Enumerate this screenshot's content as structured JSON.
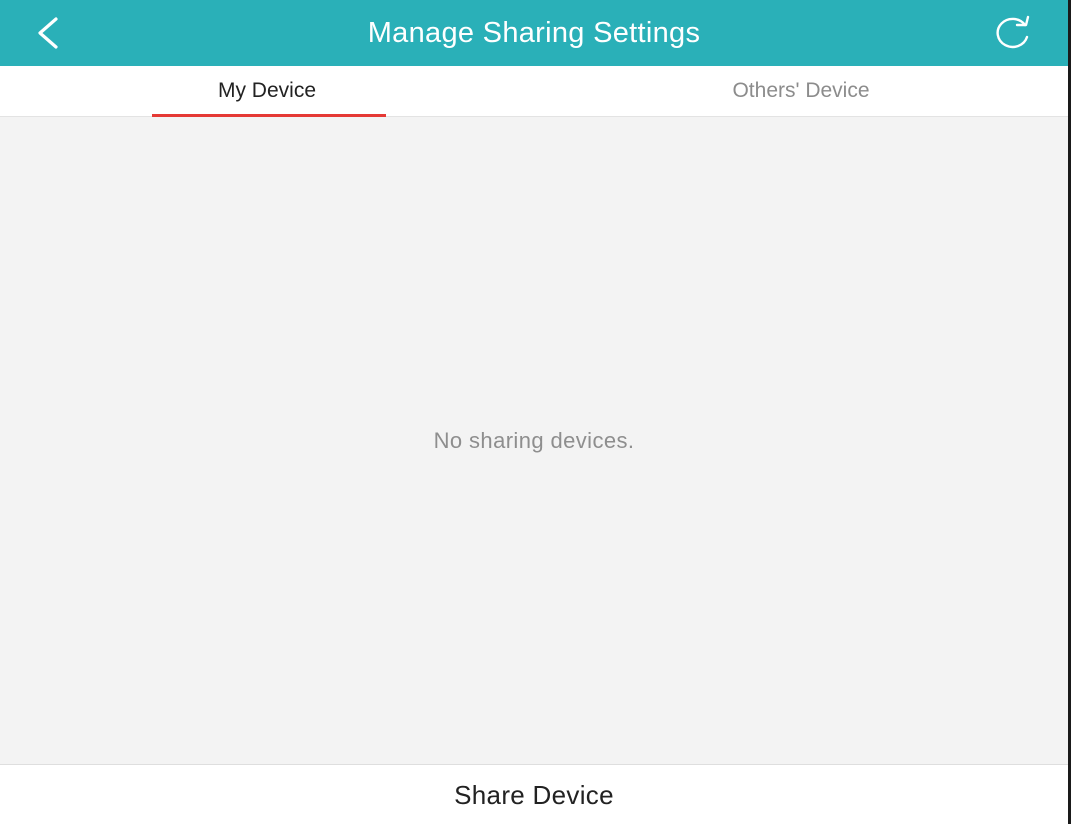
{
  "header": {
    "title": "Manage Sharing Settings",
    "back_icon": "chevron-left-icon",
    "refresh_icon": "refresh-icon",
    "background_color": "#2ab0b8"
  },
  "tabs": [
    {
      "label": "My Device",
      "active": true
    },
    {
      "label": "Others' Device",
      "active": false
    }
  ],
  "tab_indicator_color": "#e53935",
  "content": {
    "empty_message": "No sharing devices."
  },
  "footer": {
    "share_label": "Share Device"
  }
}
